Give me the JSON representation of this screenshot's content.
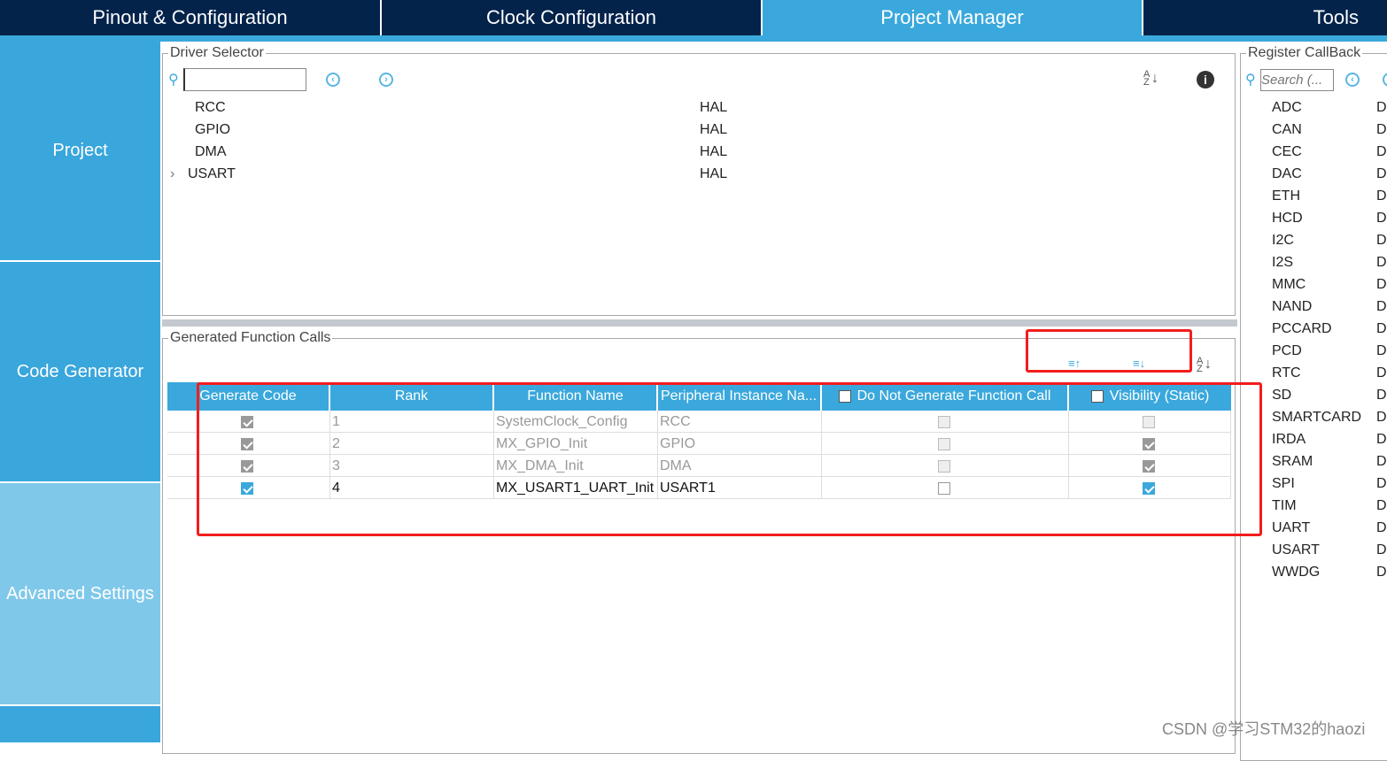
{
  "tabs": [
    {
      "label": "Pinout & Configuration"
    },
    {
      "label": "Clock Configuration"
    },
    {
      "label": "Project Manager",
      "active": true
    },
    {
      "label": "Tools"
    }
  ],
  "sidebar": {
    "items": [
      {
        "label": "Project"
      },
      {
        "label": "Code Generator"
      },
      {
        "label": "Advanced Settings",
        "active": true
      }
    ]
  },
  "driver_selector": {
    "title": "Driver Selector",
    "search_value": "",
    "rows": [
      {
        "name": "RCC",
        "driver": "HAL"
      },
      {
        "name": "GPIO",
        "driver": "HAL"
      },
      {
        "name": "DMA",
        "driver": "HAL"
      },
      {
        "name": "USART",
        "driver": "HAL",
        "expandable": true
      }
    ]
  },
  "generated_calls": {
    "title": "Generated Function Calls",
    "columns": [
      "Generate Code",
      "Rank",
      "Function Name",
      "Peripheral Instance Na...",
      "Do Not Generate Function Call",
      "Visibility (Static)"
    ],
    "rows": [
      {
        "generate": true,
        "rank": "1",
        "function": "SystemClock_Config",
        "instance": "RCC",
        "no_call": false,
        "visibility": false,
        "enabled": false
      },
      {
        "generate": true,
        "rank": "2",
        "function": "MX_GPIO_Init",
        "instance": "GPIO",
        "no_call": false,
        "visibility": true,
        "enabled": false
      },
      {
        "generate": true,
        "rank": "3",
        "function": "MX_DMA_Init",
        "instance": "DMA",
        "no_call": false,
        "visibility": true,
        "enabled": false
      },
      {
        "generate": true,
        "rank": "4",
        "function": "MX_USART1_UART_Init",
        "instance": "USART1",
        "no_call": false,
        "visibility": true,
        "enabled": true
      }
    ]
  },
  "register_callback": {
    "title": "Register CallBack",
    "search_placeholder": "Search (...",
    "items": [
      "ADC",
      "CAN",
      "CEC",
      "DAC",
      "ETH",
      "HCD",
      "I2C",
      "I2S",
      "MMC",
      "NAND",
      "PCCARD",
      "PCD",
      "RTC",
      "SD",
      "SMARTCARD",
      "IRDA",
      "SRAM",
      "SPI",
      "TIM",
      "UART",
      "USART",
      "WWDG"
    ],
    "value_prefix": "D"
  },
  "watermark": "CSDN @学习STM32的haozi",
  "colors": {
    "navy": "#03234b",
    "accent": "#3aa8dc",
    "annotation": "#f21d1d"
  }
}
